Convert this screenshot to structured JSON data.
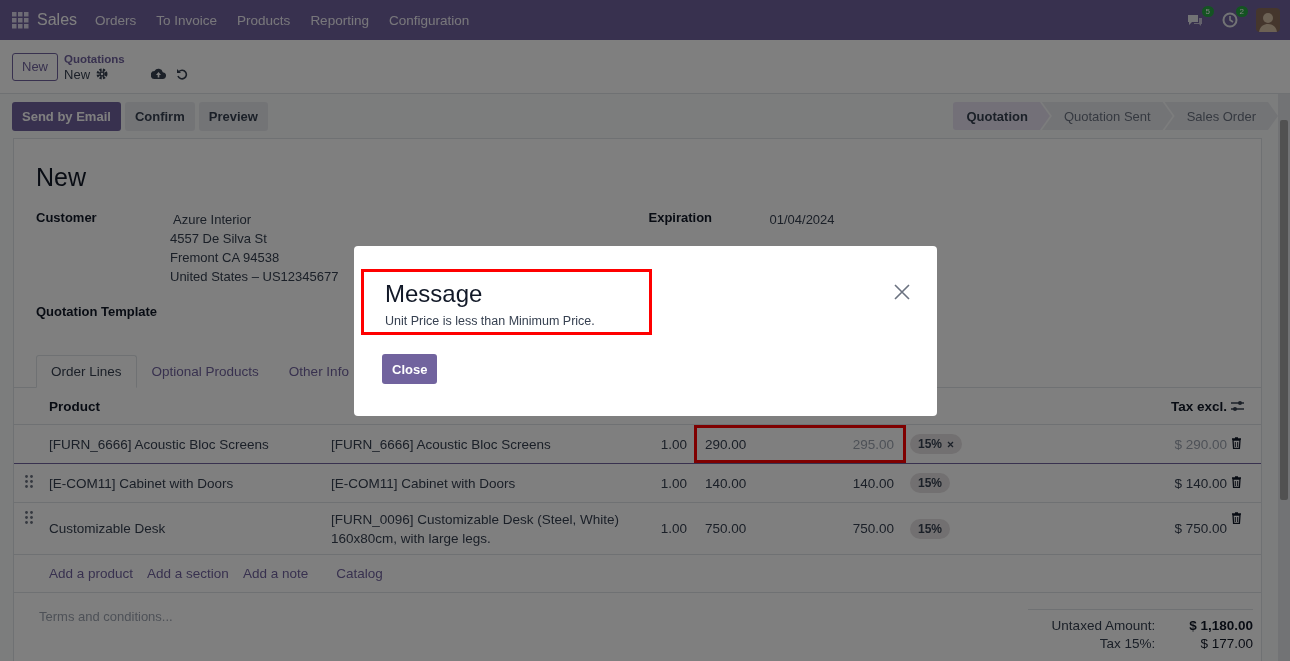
{
  "navbar": {
    "app_name": "Sales",
    "menu": [
      "Orders",
      "To Invoice",
      "Products",
      "Reporting",
      "Configuration"
    ],
    "message_count": "5",
    "activity_count": "2"
  },
  "control_panel": {
    "new_button": "New",
    "breadcrumb": "Quotations",
    "record": "New"
  },
  "actions": [
    {
      "label": "Send by Email",
      "primary": true
    },
    {
      "label": "Confirm",
      "primary": false
    },
    {
      "label": "Preview",
      "primary": false
    }
  ],
  "statusbar": [
    {
      "label": "Quotation",
      "selected": true
    },
    {
      "label": "Quotation Sent",
      "selected": false
    },
    {
      "label": "Sales Order",
      "selected": false
    }
  ],
  "form": {
    "title": "New",
    "customer_label": "Customer",
    "customer_name": "Azure Interior",
    "customer_address": [
      "4557 De Silva St",
      "Fremont CA 94538",
      "United States – US12345677"
    ],
    "expiration_label": "Expiration",
    "expiration_value": "01/04/2024",
    "template_label": "Quotation Template"
  },
  "tabs": [
    {
      "label": "Order Lines",
      "selected": true
    },
    {
      "label": "Optional Products",
      "selected": false
    },
    {
      "label": "Other Info",
      "selected": false
    }
  ],
  "table": {
    "columns": [
      "Product",
      "Tax excl."
    ],
    "rows": [
      {
        "product": "[FURN_6666] Acoustic Bloc Screens",
        "description": [
          "[FURN_6666] Acoustic Bloc Screens"
        ],
        "quantity": "1.00",
        "unit_price": "290.00",
        "minimum_price": "295.00",
        "tax": "15%",
        "subtotal": "$ 290.00",
        "editing": true,
        "flagged": true
      },
      {
        "product": "[E-COM11] Cabinet with Doors",
        "description": [
          "[E-COM11] Cabinet with Doors"
        ],
        "quantity": "1.00",
        "unit_price": "140.00",
        "minimum_price": "140.00",
        "tax": "15%",
        "subtotal": "$ 140.00",
        "editing": false,
        "flagged": false
      },
      {
        "product": "Customizable Desk",
        "description": [
          "[FURN_0096] Customizable Desk (Steel, White)",
          "160x80cm, with large legs."
        ],
        "quantity": "1.00",
        "unit_price": "750.00",
        "minimum_price": "750.00",
        "tax": "15%",
        "subtotal": "$ 750.00",
        "editing": false,
        "flagged": false
      }
    ],
    "add_links": [
      "Add a product",
      "Add a section",
      "Add a note"
    ],
    "catalog_link": "Catalog"
  },
  "terms_placeholder": "Terms and conditions...",
  "totals": [
    {
      "label": "Untaxed Amount:",
      "value": "$ 1,180.00",
      "bold": true
    },
    {
      "label": "Tax 15%:",
      "value": "$ 177.00",
      "bold": false
    }
  ],
  "dialog": {
    "title": "Message",
    "message": "Unit Price is less than Minimum Price.",
    "close_button": "Close",
    "highlighted": true
  }
}
